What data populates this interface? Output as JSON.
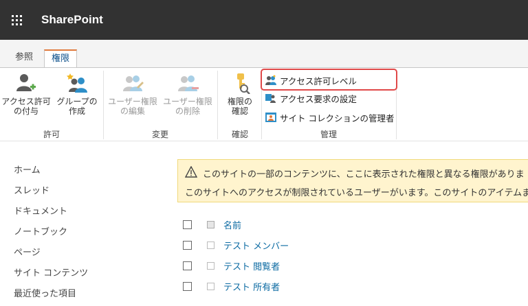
{
  "suitebar": {
    "app_name": "SharePoint",
    "waffle_icon": "waffle-icon"
  },
  "tabs": [
    {
      "label": "参照",
      "selected": false
    },
    {
      "label": "権限",
      "selected": true
    }
  ],
  "ribbon": {
    "groups": [
      {
        "label": "許可"
      },
      {
        "label": "変更"
      },
      {
        "label": "確認"
      },
      {
        "label": "管理"
      }
    ],
    "grant_button": {
      "label1": "アクセス許可",
      "label2": "の付与"
    },
    "create_group_button": {
      "label1": "グループの",
      "label2": "作成"
    },
    "edit_permissions_button": {
      "label1": "ユーザー権限",
      "label2": "の編集"
    },
    "remove_permissions_button": {
      "label1": "ユーザー権限",
      "label2": "の削除"
    },
    "check_permissions_button": {
      "label1": "権限の",
      "label2": "確認"
    },
    "manage_items": [
      {
        "label": "アクセス許可レベル",
        "highlighted": true
      },
      {
        "label": "アクセス要求の設定",
        "highlighted": false
      },
      {
        "label": "サイト コレクションの管理者",
        "highlighted": false
      }
    ],
    "highlight_color": "#e04848"
  },
  "leftnav": {
    "items": [
      "ホーム",
      "スレッド",
      "ドキュメント",
      "ノートブック",
      "ページ",
      "サイト コンテンツ",
      "最近使った項目"
    ]
  },
  "banner": {
    "line1": "このサイトの一部のコンテンツに、ここに表示された権限と異なる権限がありま す",
    "line2": "このサイトへのアクセスが制限されているユーザーがいます。このサイトのアイテムまたは",
    "icon": "warning-icon"
  },
  "list": {
    "header": "名前",
    "rows": [
      "テスト メンバー",
      "テスト 閲覧者",
      "テスト 所有者"
    ]
  }
}
